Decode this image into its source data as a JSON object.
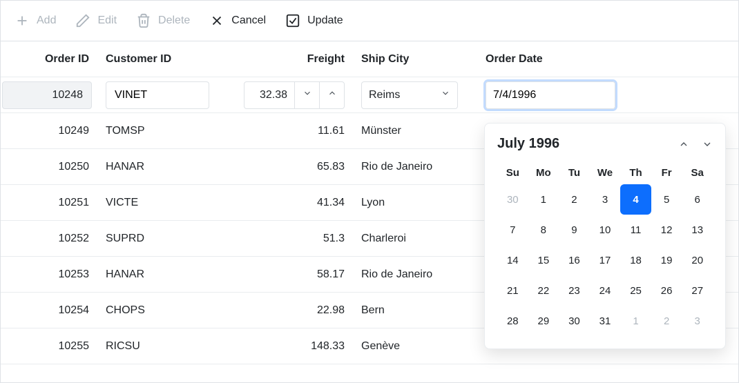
{
  "toolbar": {
    "add": {
      "label": "Add",
      "enabled": false
    },
    "edit": {
      "label": "Edit",
      "enabled": false
    },
    "delete": {
      "label": "Delete",
      "enabled": false
    },
    "cancel": {
      "label": "Cancel",
      "enabled": true
    },
    "update": {
      "label": "Update",
      "enabled": true
    }
  },
  "columns": {
    "orderId": "Order ID",
    "customerId": "Customer ID",
    "freight": "Freight",
    "shipCity": "Ship City",
    "orderDate": "Order Date"
  },
  "editRow": {
    "orderId": "10248",
    "customerId": "VINET",
    "freight": "32.38",
    "shipCity": "Reims",
    "orderDate": "7/4/1996"
  },
  "rows": [
    {
      "orderId": "10249",
      "customerId": "TOMSP",
      "freight": "11.61",
      "shipCity": "Münster"
    },
    {
      "orderId": "10250",
      "customerId": "HANAR",
      "freight": "65.83",
      "shipCity": "Rio de Janeiro"
    },
    {
      "orderId": "10251",
      "customerId": "VICTE",
      "freight": "41.34",
      "shipCity": "Lyon"
    },
    {
      "orderId": "10252",
      "customerId": "SUPRD",
      "freight": "51.3",
      "shipCity": "Charleroi"
    },
    {
      "orderId": "10253",
      "customerId": "HANAR",
      "freight": "58.17",
      "shipCity": "Rio de Janeiro"
    },
    {
      "orderId": "10254",
      "customerId": "CHOPS",
      "freight": "22.98",
      "shipCity": "Bern"
    },
    {
      "orderId": "10255",
      "customerId": "RICSU",
      "freight": "148.33",
      "shipCity": "Genève"
    }
  ],
  "calendar": {
    "title": "July 1996",
    "weekdays": [
      "Su",
      "Mo",
      "Tu",
      "We",
      "Th",
      "Fr",
      "Sa"
    ],
    "cells": [
      {
        "d": "30",
        "muted": true
      },
      {
        "d": "1"
      },
      {
        "d": "2"
      },
      {
        "d": "3"
      },
      {
        "d": "4",
        "selected": true
      },
      {
        "d": "5"
      },
      {
        "d": "6"
      },
      {
        "d": "7"
      },
      {
        "d": "8"
      },
      {
        "d": "9"
      },
      {
        "d": "10"
      },
      {
        "d": "11"
      },
      {
        "d": "12"
      },
      {
        "d": "13"
      },
      {
        "d": "14"
      },
      {
        "d": "15"
      },
      {
        "d": "16"
      },
      {
        "d": "17"
      },
      {
        "d": "18"
      },
      {
        "d": "19"
      },
      {
        "d": "20"
      },
      {
        "d": "21"
      },
      {
        "d": "22"
      },
      {
        "d": "23"
      },
      {
        "d": "24"
      },
      {
        "d": "25"
      },
      {
        "d": "26"
      },
      {
        "d": "27"
      },
      {
        "d": "28"
      },
      {
        "d": "29"
      },
      {
        "d": "30"
      },
      {
        "d": "31"
      },
      {
        "d": "1",
        "muted": true
      },
      {
        "d": "2",
        "muted": true
      },
      {
        "d": "3",
        "muted": true
      }
    ]
  }
}
